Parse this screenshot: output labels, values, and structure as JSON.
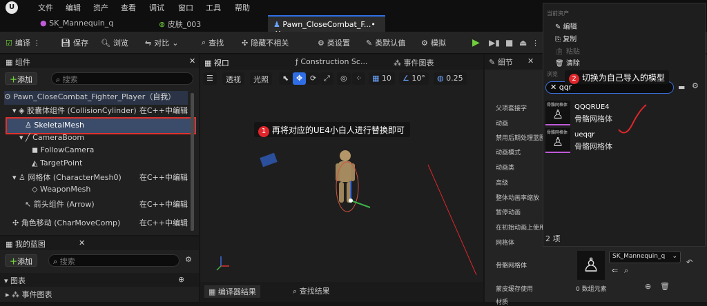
{
  "menu": [
    "文件",
    "编辑",
    "资产",
    "查看",
    "调试",
    "窗口",
    "工具",
    "帮助"
  ],
  "tabs": [
    "SK_Mannequin_q",
    "皮肤_003",
    "Pawn_CloseCombat_F...•"
  ],
  "toolbar": {
    "compile": "编译",
    "save": "保存",
    "browse": "浏览",
    "diff": "对比",
    "find": "查找",
    "hide_unrelated": "隐藏不相关",
    "class_settings": "类设置",
    "class_defaults": "类默认值",
    "simulate": "模拟"
  },
  "components": {
    "title": "组件",
    "add": "添加",
    "search_placeholder": "搜索",
    "items": [
      {
        "label": "Pawn_CloseCombat_Fighter_Player（自我）",
        "edit": ""
      },
      {
        "label": "胶囊体组件 (CollisionCylinder)",
        "edit": "在C++中编辑"
      },
      {
        "label": "SkeletalMesh",
        "edit": ""
      },
      {
        "label": "CameraBoom",
        "edit": ""
      },
      {
        "label": "FollowCamera",
        "edit": ""
      },
      {
        "label": "TargetPoint",
        "edit": ""
      },
      {
        "label": "网格体 (CharacterMesh0)",
        "edit": "在C++中编辑"
      },
      {
        "label": "WeaponMesh",
        "edit": ""
      },
      {
        "label": "箭头组件 (Arrow)",
        "edit": "在C++中编辑"
      },
      {
        "label": "角色移动 (CharMoveComp)",
        "edit": "在C++中编辑"
      }
    ]
  },
  "blueprint": {
    "title": "我的蓝图",
    "add": "添加",
    "search_placeholder": "搜索",
    "graphs": "图表",
    "event_graph": "事件图表"
  },
  "viewport_tabs": [
    "视口",
    "Construction Sc...",
    "事件图表"
  ],
  "viewport_toolbar": {
    "perspective": "透视",
    "lit": "光照",
    "grid": "10",
    "angle": "10°",
    "scale": "0.25"
  },
  "annotation1": {
    "num": "1",
    "text": "再将对应的UE4小白人进行替换即可"
  },
  "annotation2": {
    "num": "2",
    "text": "切换为自己导入的模型"
  },
  "bottom_tabs": [
    "编译器结果",
    "查找结果"
  ],
  "details": {
    "title": "细节",
    "rows": [
      "父项套接字",
      "动画",
      "禁用后期处理蓝图",
      "动画模式",
      "动画类",
      "高级",
      "整体动画率缩放",
      "暂停动画",
      "在初始动画上使用",
      "网格体",
      "骨骼网格体",
      "蒙皮缓存使用",
      "材质"
    ],
    "mesh_value": "SK_Mannequin_q",
    "array_count": "0 数组元素"
  },
  "context_menu": {
    "header": "当前资产",
    "items": [
      "编辑",
      "复制",
      "粘贴",
      "清除"
    ],
    "browse_label": "浏览",
    "search_value": "qqr",
    "results": [
      {
        "thumb": "骨骼网格体",
        "name": "QQQRUE4",
        "type": "骨骼网格体"
      },
      {
        "thumb": "骨骼网格体",
        "name": "ueqqr",
        "type": "骨骼网格体"
      }
    ],
    "count": "2 项"
  },
  "colors": {
    "accent": "#2f6ee6",
    "annotation": "#e0262b",
    "play": "#6fcf3b",
    "highlight": "#e0312b"
  }
}
